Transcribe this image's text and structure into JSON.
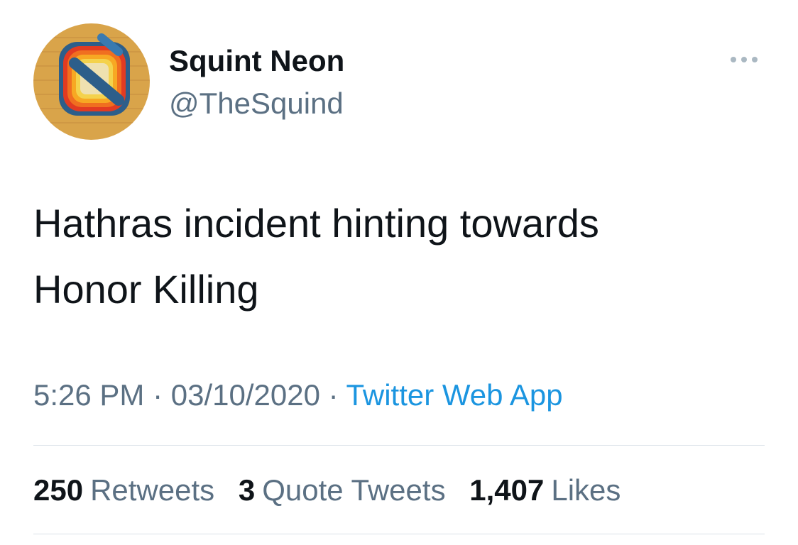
{
  "author": {
    "display_name": "Squint Neon",
    "handle": "@TheSquind",
    "avatar_icon": "squint-neon-logo"
  },
  "more_menu": {
    "icon": "more-dots-icon"
  },
  "tweet": {
    "text": "Hathras incident hinting towards\nHonor Killing"
  },
  "meta": {
    "time": "5:26 PM",
    "separator": " · ",
    "date": "03/10/2020",
    "source": "Twitter Web App"
  },
  "stats": [
    {
      "count": "250",
      "label": "Retweets"
    },
    {
      "count": "3",
      "label": "Quote Tweets"
    },
    {
      "count": "1,407",
      "label": "Likes"
    }
  ],
  "colors": {
    "text_primary": "#0f1419",
    "text_secondary": "#5b7083",
    "link": "#1b95e0",
    "divider": "#dbe2e8"
  }
}
